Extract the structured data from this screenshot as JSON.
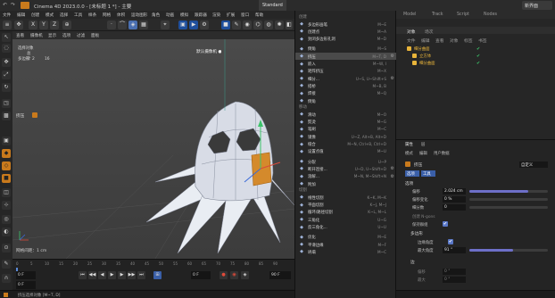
{
  "window": {
    "title": "Cinema 4D 2023.0.0 - [未标题 1 *] - 主要"
  },
  "layout_tabs": [
    "Standard",
    "Model",
    "Track",
    "Script",
    "Nodes"
  ],
  "new_layout": "新界面",
  "menubar": [
    "文件",
    "编辑",
    "创建",
    "模式",
    "选择",
    "工具",
    "样条",
    "网格",
    "体积",
    "运动图形",
    "角色",
    "动画",
    "模拟",
    "跟踪器",
    "渲染",
    "扩展",
    "窗口",
    "帮助"
  ],
  "toolbar": {
    "axes": [
      "X",
      "Y",
      "Z"
    ]
  },
  "viewport": {
    "menu": [
      "查看",
      "摄像机",
      "显示",
      "选项",
      "过滤",
      "面板"
    ],
    "camera_label": "默认摄像机 ●",
    "stats": {
      "title": "选择对象",
      "total_label": "总计",
      "rows": [
        {
          "label": "多边形",
          "a": "2",
          "b": "16"
        }
      ]
    },
    "left_label": "挤压",
    "grid_label": "网格间距：1 cm"
  },
  "dropdown": {
    "sections": [
      {
        "title": "创建",
        "items": [
          {
            "icon": "polygon-pen",
            "label": "多边形画笔",
            "shortcut": "M~E"
          },
          {
            "icon": "create-point",
            "label": "创建点",
            "shortcut": "M~A"
          },
          {
            "icon": "close-hole",
            "label": "封闭多边形孔洞",
            "shortcut": "M~D"
          }
        ]
      },
      {
        "title": "",
        "items": [
          {
            "icon": "bevel",
            "label": "倒角",
            "shortcut": "M~S"
          },
          {
            "icon": "extrude",
            "label": "挤压",
            "shortcut": "M~T, D",
            "gear": true,
            "highlighted": true
          },
          {
            "icon": "inner-extrude",
            "label": "嵌入",
            "shortcut": "M~W, I"
          },
          {
            "icon": "matrix-extrude",
            "label": "矩阵挤压",
            "shortcut": "M~X"
          },
          {
            "icon": "smooth-shift",
            "label": "细分...",
            "shortcut": "U~S, U~Shift+S",
            "gear": true
          },
          {
            "icon": "bridge",
            "label": "搭桥",
            "shortcut": "M~B, B"
          },
          {
            "icon": "weld",
            "label": "焊接",
            "shortcut": "M~Q"
          },
          {
            "icon": "bevel-2",
            "label": "倒角",
            "shortcut": ""
          }
        ]
      },
      {
        "title": "移动",
        "items": [
          {
            "icon": "slide",
            "label": "滑动",
            "shortcut": "M~O"
          },
          {
            "icon": "iron",
            "label": "熨烫",
            "shortcut": "M~G"
          },
          {
            "icon": "brush",
            "label": "笔刷",
            "shortcut": "M~C"
          },
          {
            "icon": "mirror",
            "label": "镜像",
            "shortcut": "U~Z, Alt+B, Alt+D"
          },
          {
            "icon": "stitch",
            "label": "缝合",
            "shortcut": "M~N, Ctrl+B, Ctrl+D"
          },
          {
            "icon": "set-value",
            "label": "设置点值",
            "shortcut": "M~U"
          }
        ]
      },
      {
        "title": "",
        "items": [
          {
            "icon": "split",
            "label": "分裂",
            "shortcut": "U~P"
          },
          {
            "icon": "weld-2",
            "label": "断开连接...",
            "shortcut": "U~D, U~Shift+D",
            "gear": true
          },
          {
            "icon": "melt",
            "label": "溶解...",
            "shortcut": "M~N, M~Shift+N",
            "gear": true
          },
          {
            "icon": "sep",
            "label": "附加",
            "shortcut": ""
          }
        ]
      },
      {
        "title": "切割",
        "items": [
          {
            "icon": "line-cut",
            "label": "线性切割",
            "shortcut": "K~K, M~K"
          },
          {
            "icon": "plane-cut",
            "label": "平面切割",
            "shortcut": "K~J, M~J"
          },
          {
            "icon": "loop-cut",
            "label": "循环/路径切割",
            "shortcut": "K~L, M~L"
          },
          {
            "icon": "knife",
            "label": "三角化",
            "shortcut": "U~G"
          },
          {
            "icon": "untriangulate",
            "label": "反三角化...",
            "shortcut": "U~U"
          }
        ]
      },
      {
        "title": "",
        "items": [
          {
            "icon": "optimize",
            "label": "优化",
            "shortcut": "M~E"
          },
          {
            "icon": "smooth",
            "label": "平滑边缘",
            "shortcut": "M~F"
          },
          {
            "icon": "reorder",
            "label": "坍塌",
            "shortcut": "M~C"
          }
        ]
      }
    ]
  },
  "object_manager": {
    "top_tabs": [
      "对象",
      "场次"
    ],
    "menu": [
      "文件",
      "编辑",
      "查看",
      "对象",
      "标签",
      "书签"
    ],
    "objects": [
      {
        "name": "细分曲面",
        "color": "#e8b43a",
        "indent": 0
      },
      {
        "name": "立方体",
        "color": "#e8b43a",
        "indent": 1
      },
      {
        "name": "细分曲面",
        "color": "#e8b43a",
        "indent": 1
      }
    ]
  },
  "right_top_tabs": [
    "Model",
    "Track",
    "Script",
    "Nodes"
  ],
  "attributes": {
    "tabs": [
      "属性",
      "层"
    ],
    "menu": [
      "模式",
      "编辑",
      "用户数据"
    ],
    "tool_name": "挤压",
    "subtabs": [
      "选项",
      "工具"
    ],
    "preset_label": "自定义",
    "section": "选项",
    "fields": [
      {
        "label": "偏移",
        "value": "2.024 cm",
        "fill": 0.75
      },
      {
        "label": "偏移变化",
        "value": "0 %",
        "fill": 0.0
      },
      {
        "label": "细分数",
        "value": "0",
        "fill": 0.0
      },
      {
        "label": "创建 N-gons",
        "value": ""
      },
      {
        "label": "保持群组",
        "value": "✔"
      }
    ],
    "section2": "多边形",
    "edge_angle_label": "边缘角度",
    "max_angle_label": "最大角度",
    "max_angle_value": "91 °",
    "section3": "边",
    "sub_fields": [
      {
        "label": "偏移",
        "value": "0 °"
      },
      {
        "label": "最大",
        "value": "0 °"
      }
    ]
  },
  "timeline": {
    "ticks": [
      "0",
      "5",
      "10",
      "15",
      "20",
      "25",
      "30",
      "35",
      "40",
      "45",
      "50",
      "55",
      "60",
      "65",
      "70",
      "75",
      "80",
      "85",
      "90"
    ],
    "start": "0 F",
    "current": "0 F",
    "end": "90 F",
    "range_end": "90 F"
  },
  "status": {
    "text": "挤压选择对象 [M~T, D]"
  },
  "colors": {
    "accent": "#4a6fb0",
    "orange": "#c97a1c",
    "bg": "#1e1e1e"
  }
}
